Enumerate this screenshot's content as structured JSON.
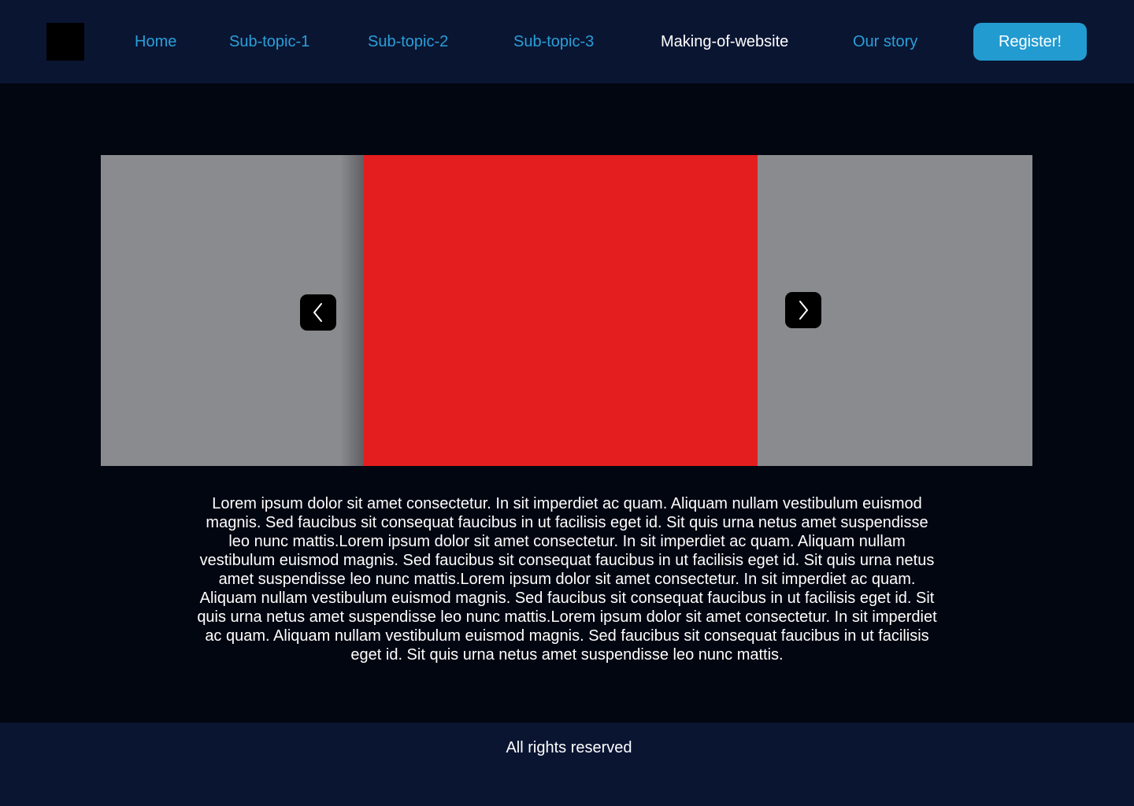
{
  "header": {
    "nav": [
      {
        "label": "Home",
        "active": false
      },
      {
        "label": "Sub-topic-1",
        "active": false
      },
      {
        "label": "Sub-topic-2",
        "active": false
      },
      {
        "label": "Sub-topic-3",
        "active": false
      },
      {
        "label": "Making-of-website",
        "active": true
      },
      {
        "label": "Our story",
        "active": false
      }
    ],
    "register_label": "Register!"
  },
  "carousel": {
    "prev_icon": "chevron-left-icon",
    "next_icon": "chevron-right-icon"
  },
  "main": {
    "body_text": "Lorem ipsum dolor sit amet consectetur. In sit imperdiet ac quam. Aliquam nullam vestibulum euismod magnis. Sed faucibus sit consequat faucibus in ut facilisis eget id. Sit quis urna netus amet suspendisse leo nunc mattis.Lorem ipsum dolor sit amet consectetur. In sit imperdiet ac quam. Aliquam nullam vestibulum euismod magnis. Sed faucibus sit consequat faucibus in ut facilisis eget id. Sit quis urna netus amet suspendisse leo nunc mattis.Lorem ipsum dolor sit amet consectetur. In sit imperdiet ac quam. Aliquam nullam vestibulum euismod magnis. Sed faucibus sit consequat faucibus in ut facilisis eget id. Sit quis urna netus amet suspendisse leo nunc mattis.Lorem ipsum dolor sit amet consectetur. In sit imperdiet ac quam. Aliquam nullam vestibulum euismod magnis. Sed faucibus sit consequat faucibus in ut facilisis eget id. Sit quis urna netus amet suspendisse leo nunc mattis."
  },
  "footer": {
    "text": "All rights reserved"
  },
  "colors": {
    "header_bg": "#0a1532",
    "page_bg": "#020611",
    "nav_link": "#2a9fd8",
    "nav_active": "#ffffff",
    "accent": "#229bd1",
    "slide_main": "#e41e1e",
    "slide_side": "#8a8b8f"
  }
}
